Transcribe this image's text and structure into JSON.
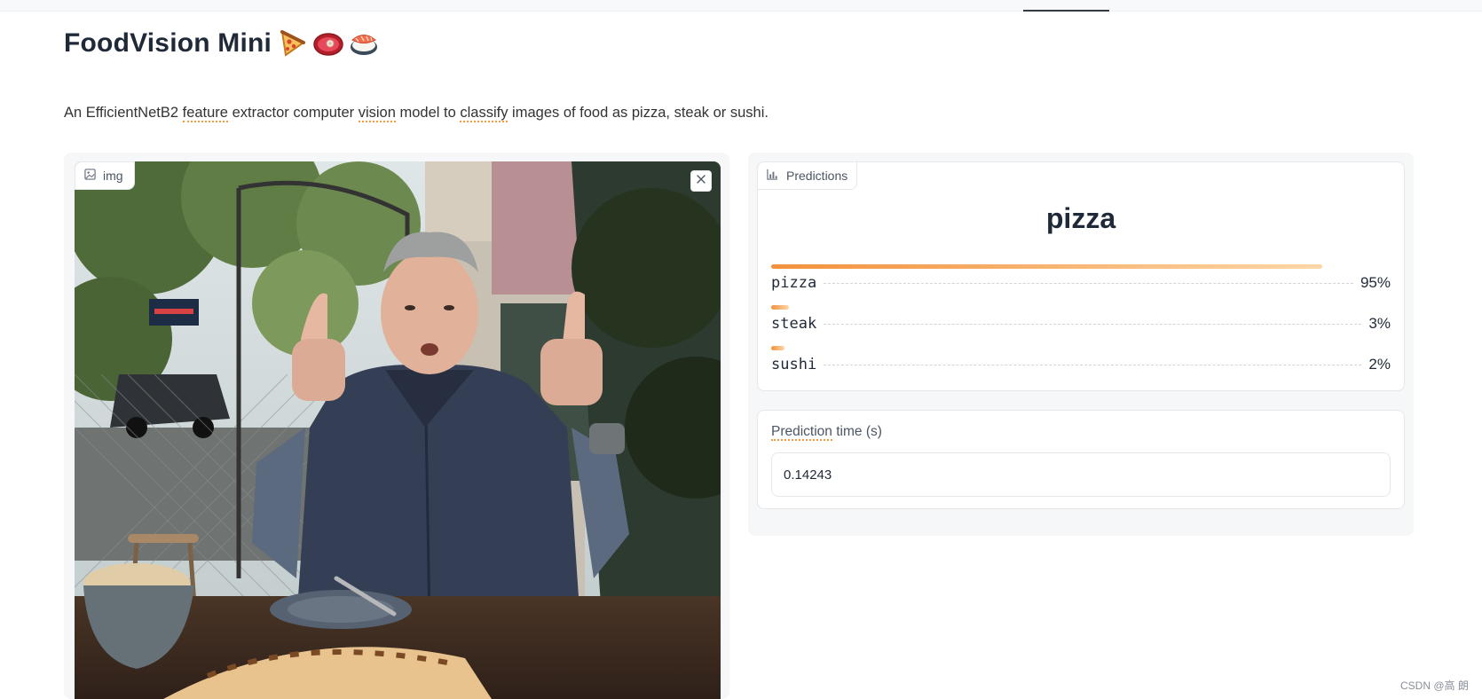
{
  "header": {
    "title": "FoodVision Mini",
    "icons": [
      "pizza-emoji",
      "steak-emoji",
      "sushi-emoji"
    ]
  },
  "description": {
    "part1": "An EfficientNetB2 ",
    "feature": "feature",
    "part2": " extractor computer ",
    "vision": "vision",
    "part3": " model to ",
    "classify": "classify",
    "part4": " images of food as pizza, steak or sushi."
  },
  "image_input": {
    "label": "img",
    "content": "photo of man giving thumbs up with pizza on table"
  },
  "predictions": {
    "label": "Predictions",
    "top_label": "pizza",
    "confidences": [
      {
        "name": "pizza",
        "value_text": "95%",
        "value": 0.95
      },
      {
        "name": "steak",
        "value_text": "3%",
        "value": 0.03
      },
      {
        "name": "sushi",
        "value_text": "2%",
        "value": 0.02
      }
    ]
  },
  "prediction_time": {
    "label_underlined": "Prediction",
    "label_rest": " time (s)",
    "value": "0.14243"
  },
  "watermark": "CSDN @高 朗",
  "colors": {
    "accent": "#f2913c",
    "accent_light": "#fed6a6",
    "panel_bg": "#f6f7f9",
    "border": "#e5e7eb"
  }
}
